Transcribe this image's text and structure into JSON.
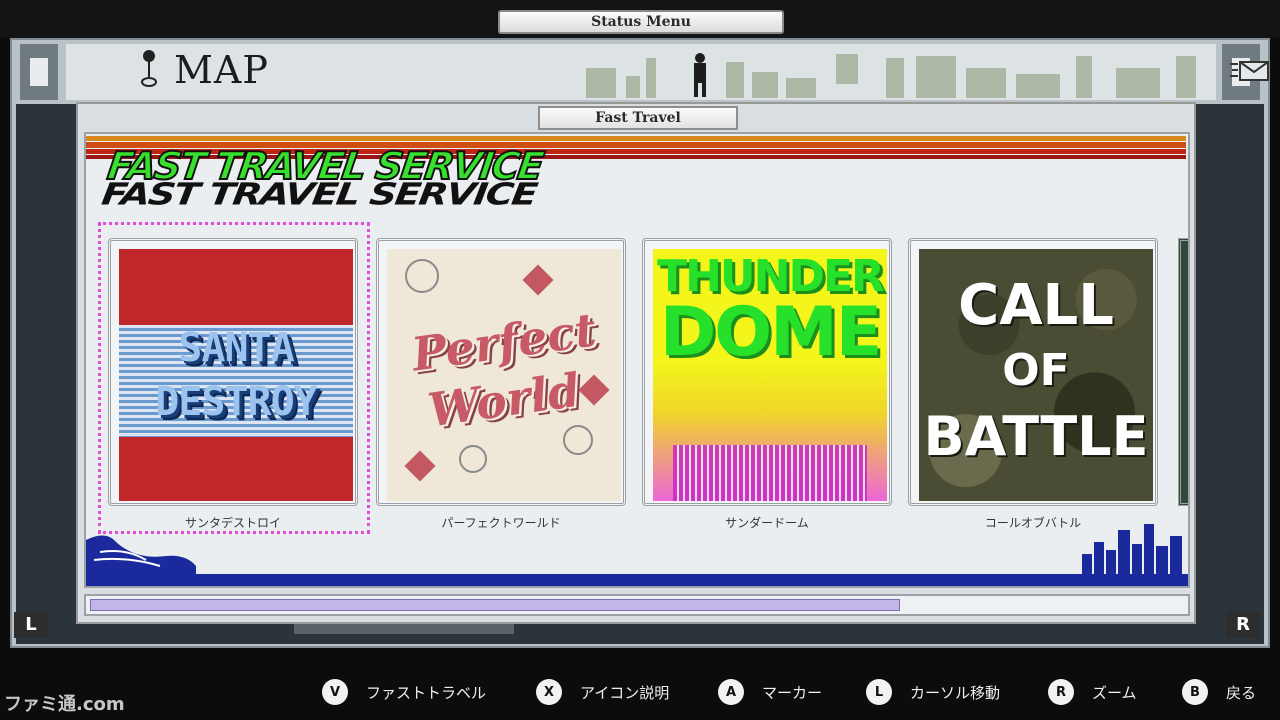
{
  "status_menu": {
    "title": "Status Menu"
  },
  "map": {
    "title": "MAP"
  },
  "nav": {
    "left": "L",
    "right": "R"
  },
  "fast_travel": {
    "window_title": "Fast Travel",
    "logo_text": "FAST TRAVEL SERVICE",
    "destinations": [
      {
        "label": "サンタデストロイ",
        "art_lines": [
          "SANTA",
          "DESTROY"
        ],
        "selected": true
      },
      {
        "label": "パーフェクトワールド",
        "art_lines": [
          "Perfect",
          "World"
        ],
        "selected": false
      },
      {
        "label": "サンダードーム",
        "art_lines": [
          "THUNDER",
          "DOME"
        ],
        "selected": false
      },
      {
        "label": "コールオブバトル",
        "art_lines": [
          "CALL",
          "OF",
          "BATTLE"
        ],
        "selected": false
      }
    ],
    "scroll_progress": 0.74
  },
  "controls": [
    {
      "button": "V",
      "label": "ファストトラベル",
      "icon": "v-button-icon"
    },
    {
      "button": "X",
      "label": "アイコン説明",
      "icon": "x-button-icon"
    },
    {
      "button": "A",
      "label": "マーカー",
      "icon": "a-button-icon"
    },
    {
      "button": "L",
      "label": "カーソル移動",
      "icon": "left-stick-icon"
    },
    {
      "button": "R",
      "label": "ズーム",
      "icon": "right-stick-icon"
    },
    {
      "button": "B",
      "label": "戻る",
      "icon": "b-button-icon"
    }
  ],
  "watermark": "ファミ通.com",
  "colors": {
    "selection": "#e24bd8",
    "logo_green": "#37e02c",
    "scroll_thumb": "#c3b6e6"
  }
}
